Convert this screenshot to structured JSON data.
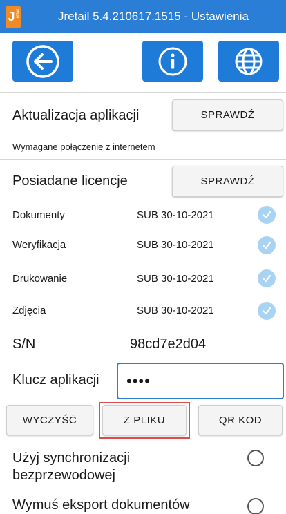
{
  "titlebar": {
    "logo_letter": "J",
    "logo_sub": "retail",
    "title": "Jretail 5.4.210617.1515 - Ustawienia"
  },
  "toolbar": {
    "icons": [
      "back-arrow-icon",
      "info-icon",
      "globe-icon"
    ],
    "accent": "#1f7bd8"
  },
  "update": {
    "label": "Aktualizacja aplikacji",
    "button": "SPRAWDŹ",
    "note": "Wymagane połączenie z internetem"
  },
  "licenses": {
    "label": "Posiadane licencje",
    "button": "SPRAWDŹ",
    "items": [
      {
        "name": "Dokumenty",
        "value": "SUB 30-10-2021"
      },
      {
        "name": "Weryfikacja",
        "value": "SUB 30-10-2021"
      },
      {
        "name": "Drukowanie",
        "value": "SUB 30-10-2021"
      },
      {
        "name": "Zdjęcia",
        "value": "SUB 30-10-2021"
      }
    ]
  },
  "serial": {
    "label": "S/N",
    "value": "98cd7e2d04"
  },
  "key": {
    "label": "Klucz aplikacji",
    "value": "••••"
  },
  "key_actions": {
    "clear": "WYCZYŚĆ",
    "from_file": "Z PLIKU",
    "qr": "QR KOD"
  },
  "options": {
    "wireless_sync": "Użyj synchronizacji bezprzewodowej",
    "force_export": "Wymuś eksport dokumentów"
  },
  "colors": {
    "titlebar": "#2a7ed6",
    "highlight": "#e04a4a",
    "check": "#a9d3f3"
  }
}
